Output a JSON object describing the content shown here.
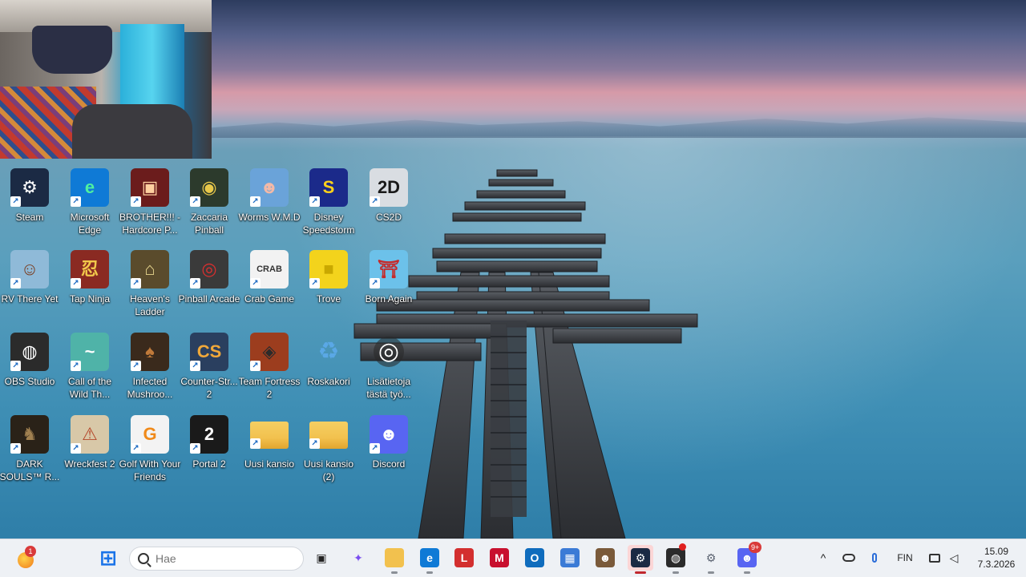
{
  "desktop": {
    "icons": [
      {
        "label": "Steam",
        "icon": "steam-icon",
        "bg": "#1b2a44",
        "glyph": "⚙",
        "fg": "#ffffff"
      },
      {
        "label": "Microsoft Edge",
        "icon": "edge-icon",
        "bg": "#0f7ad6",
        "glyph": "e",
        "fg": "#4ef0a0"
      },
      {
        "label": "BROTHER!!! - Hardcore P...",
        "icon": "brother-game-icon",
        "bg": "#6b1c1c",
        "glyph": "▣",
        "fg": "#ffd0a0"
      },
      {
        "label": "Zaccaria Pinball",
        "icon": "zaccaria-pinball-icon",
        "bg": "#2c3a2c",
        "glyph": "◉",
        "fg": "#e8c84a"
      },
      {
        "label": "Worms W.M.D",
        "icon": "worms-icon",
        "bg": "#6aa3d9",
        "glyph": "☻",
        "fg": "#f3b9a7"
      },
      {
        "label": "Disney Speedstorm",
        "icon": "disney-speedstorm-icon",
        "bg": "#1b2a8a",
        "glyph": "S",
        "fg": "#ffd21a"
      },
      {
        "label": "CS2D",
        "icon": "cs2d-icon",
        "bg": "#d9dde2",
        "glyph": "2D",
        "fg": "#1a1a1a"
      },
      {
        "label": "RV There Yet",
        "icon": "rv-there-yet-icon",
        "bg": "#8fbad8",
        "glyph": "☺",
        "fg": "#7a3b1d"
      },
      {
        "label": "Tap Ninja",
        "icon": "tap-ninja-icon",
        "bg": "#8a2a22",
        "glyph": "忍",
        "fg": "#f2c84b"
      },
      {
        "label": "Heaven's Ladder",
        "icon": "heavens-ladder-icon",
        "bg": "#5a4b2c",
        "glyph": "⌂",
        "fg": "#e7d58e"
      },
      {
        "label": "Pinball Arcade",
        "icon": "pinball-arcade-icon",
        "bg": "#3a3a3a",
        "glyph": "◎",
        "fg": "#d92f2f"
      },
      {
        "label": "Crab Game",
        "icon": "crab-game-icon",
        "bg": "#f2f2f2",
        "glyph": "CRAB",
        "fg": "#333333"
      },
      {
        "label": "Trove",
        "icon": "trove-icon",
        "bg": "#f3d31c",
        "glyph": "■",
        "fg": "#c9a800"
      },
      {
        "label": "Born Again",
        "icon": "born-again-icon",
        "bg": "#6cc1ea",
        "glyph": "⛩",
        "fg": "#c62a2a"
      },
      {
        "label": "OBS Studio",
        "icon": "obs-studio-icon",
        "bg": "#2b2b2b",
        "glyph": "◍",
        "fg": "#ffffff"
      },
      {
        "label": "Call of the Wild Th...",
        "icon": "call-of-the-wild-icon",
        "bg": "#4fb3a8",
        "glyph": "~",
        "fg": "#ffffff"
      },
      {
        "label": "Infected Mushroo...",
        "icon": "infected-mushroom-icon",
        "bg": "#3a2a1c",
        "glyph": "♠",
        "fg": "#c07a3a"
      },
      {
        "label": "Counter-Str... 2",
        "icon": "counter-strike-2-icon",
        "bg": "#2a3f5f",
        "glyph": "CS",
        "fg": "#f0a83a"
      },
      {
        "label": "Team Fortress 2",
        "icon": "team-fortress-2-icon",
        "bg": "#9c3d1e",
        "glyph": "◈",
        "fg": "#2b2b2b"
      },
      {
        "label": "Roskakori",
        "icon": "recycle-bin-icon",
        "bg": "transparent",
        "glyph": "♻",
        "fg": "#5aa8e6"
      },
      {
        "label": "Lisätietoja tästä työ...",
        "icon": "learn-about-picture-icon",
        "bg": "transparent",
        "glyph": "◎",
        "fg": "#ffffff"
      },
      {
        "label": "DARK SOULS™ R...",
        "icon": "dark-souls-icon",
        "bg": "#2a2218",
        "glyph": "♞",
        "fg": "#a08050"
      },
      {
        "label": "Wreckfest 2",
        "icon": "wreckfest-2-icon",
        "bg": "#d8c8a8",
        "glyph": "⚠",
        "fg": "#b4462a"
      },
      {
        "label": "Golf With Your Friends",
        "icon": "golf-with-your-friends-icon",
        "bg": "#f3f3f3",
        "glyph": "G",
        "fg": "#f08a1a"
      },
      {
        "label": "Portal 2",
        "icon": "portal-2-icon",
        "bg": "#1a1a1a",
        "glyph": "2",
        "fg": "#ffffff"
      },
      {
        "label": "Uusi kansio",
        "icon": "folder-icon",
        "bg": "#f2c14e",
        "glyph": "",
        "fg": "#a87a1c"
      },
      {
        "label": "Uusi kansio (2)",
        "icon": "folder-icon",
        "bg": "#f2c14e",
        "glyph": "",
        "fg": "#a87a1c"
      },
      {
        "label": "Discord",
        "icon": "discord-icon",
        "bg": "#5865f2",
        "glyph": "☻",
        "fg": "#ffffff"
      }
    ]
  },
  "taskbar": {
    "weather_badge": "1",
    "search_placeholder": "Hae",
    "apps": [
      {
        "name": "start-icon",
        "glyph": "⊞",
        "bg": "transparent",
        "fg": "#1a73e8"
      },
      {
        "name": "task-view-icon",
        "glyph": "▣",
        "bg": "transparent",
        "fg": "#222222"
      },
      {
        "name": "copilot-icon",
        "glyph": "✦",
        "bg": "transparent",
        "fg": "#7a4df0"
      },
      {
        "name": "file-explorer-icon",
        "glyph": "▬",
        "bg": "#f2c14e",
        "fg": "#f2c14e"
      },
      {
        "name": "edge-icon",
        "glyph": "e",
        "bg": "#0f7ad6",
        "fg": "#ffffff"
      },
      {
        "name": "lastpass-icon",
        "glyph": "L",
        "bg": "#d32f2f",
        "fg": "#ffffff"
      },
      {
        "name": "mcafee-icon",
        "glyph": "M",
        "bg": "#c8102e",
        "fg": "#ffffff"
      },
      {
        "name": "outlook-icon",
        "glyph": "O",
        "bg": "#0f6cbd",
        "fg": "#ffffff"
      },
      {
        "name": "microsoft-store-icon",
        "glyph": "▦",
        "bg": "#3b7bd6",
        "fg": "#ffffff"
      },
      {
        "name": "game-avatar-icon",
        "glyph": "☻",
        "bg": "#7a5a3a",
        "fg": "#ffffff"
      },
      {
        "name": "steam-icon",
        "glyph": "⚙",
        "bg": "#1b2a44",
        "fg": "#ffffff"
      },
      {
        "name": "obs-studio-icon",
        "glyph": "◍",
        "bg": "#2b2b2b",
        "fg": "#ffffff"
      },
      {
        "name": "settings-gear-icon",
        "glyph": "⚙",
        "bg": "transparent",
        "fg": "#5a6270"
      },
      {
        "name": "discord-icon",
        "glyph": "☻",
        "bg": "#5865f2",
        "fg": "#ffffff"
      }
    ],
    "discord_badge": "9+",
    "language": "FIN",
    "time": "15.09",
    "date": "7.3.2026"
  }
}
